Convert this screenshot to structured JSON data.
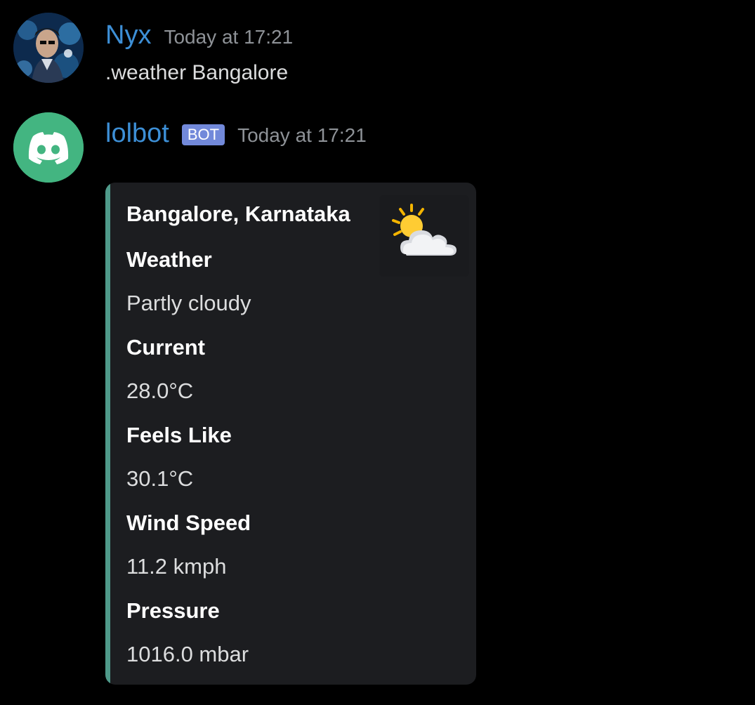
{
  "messages": [
    {
      "username": "Nyx",
      "timestamp": "Today at 17:21",
      "content": ".weather Bangalore",
      "avatar_icon": "user-avatar-photo"
    },
    {
      "username": "lolbot",
      "badge": "BOT",
      "timestamp": "Today at 17:21",
      "avatar_icon": "discord-logo-icon",
      "avatar_color": "#43b581"
    }
  ],
  "embed": {
    "accent_color": "#4f9a8a",
    "title": "Bangalore, Karnataka",
    "thumbnail_icon": "partly-cloudy-icon",
    "fields": [
      {
        "name": "Weather",
        "value": "Partly cloudy"
      },
      {
        "name": "Current",
        "value": "28.0°C"
      },
      {
        "name": "Feels Like",
        "value": "30.1°C"
      },
      {
        "name": "Wind Speed",
        "value": "11.2 kmph"
      },
      {
        "name": "Pressure",
        "value": "1016.0 mbar"
      }
    ]
  },
  "colors": {
    "background": "#000000",
    "username": "#3d8fd6",
    "timestamp": "#8e9297",
    "bot_badge": "#7289da",
    "embed_background": "#1c1d20"
  }
}
